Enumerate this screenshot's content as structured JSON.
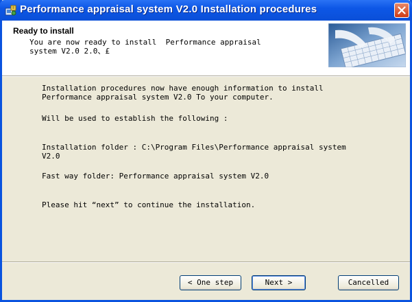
{
  "window": {
    "title": "Performance appraisal system V2.0 Installation procedures"
  },
  "header": {
    "title": "Ready to install",
    "subtitle": "You are now ready to install  Performance appraisal\nsystem V2.0 2.0、£"
  },
  "body": {
    "intro": "Installation procedures now have enough information to install\nPerformance appraisal system V2.0 To your computer.",
    "will_be_used": "Will be used to establish the following :",
    "install_folder": "Installation folder : C:\\Program Files\\Performance appraisal system\nV2.0",
    "fast_way": "Fast way folder: Performance appraisal system V2.0",
    "hint": "Please hit “next” to continue the installation."
  },
  "buttons": {
    "back": "< One step",
    "next": "Next >",
    "cancel": "Cancelled"
  },
  "colors": {
    "titlebar": "#0a53df",
    "dialog_bg": "#ece9d8",
    "close": "#cf3a14"
  },
  "icons": {
    "app": "installer-icon",
    "close": "close-icon",
    "banner": "keyboard-hands-banner"
  }
}
